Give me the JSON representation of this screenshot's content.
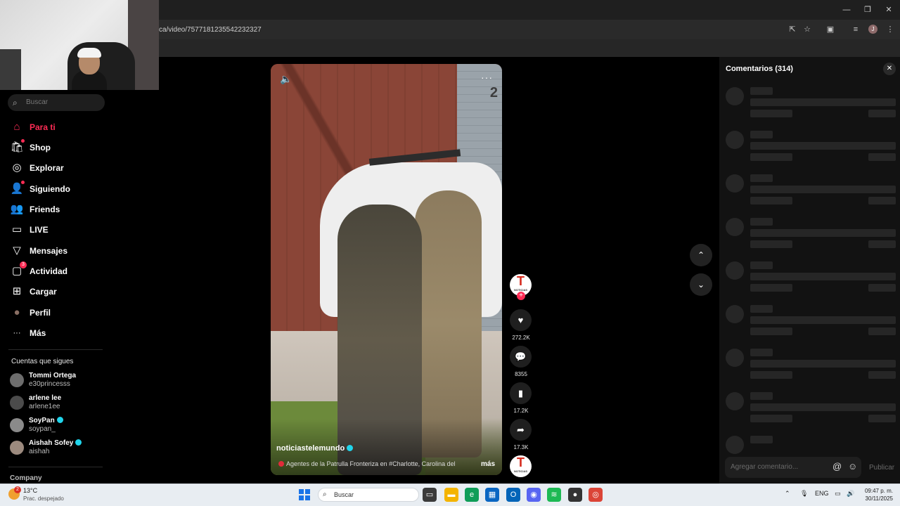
{
  "browser": {
    "url": "ca/video/7577181235542232327",
    "window_controls": {
      "minimize": "—",
      "restore": "❐",
      "close": "✕"
    },
    "profile_initial": "J"
  },
  "sidebar": {
    "search_placeholder": "Buscar",
    "items": [
      {
        "label": "Para ti",
        "icon": "⌂",
        "active": true
      },
      {
        "label": "Shop",
        "icon": "🛍"
      },
      {
        "label": "Explorar",
        "icon": "◎"
      },
      {
        "label": "Siguiendo",
        "icon": "👤"
      },
      {
        "label": "Friends",
        "icon": "👥"
      },
      {
        "label": "LIVE",
        "icon": "▭"
      },
      {
        "label": "Mensajes",
        "icon": "▽"
      },
      {
        "label": "Actividad",
        "icon": "▢",
        "badge": "3"
      },
      {
        "label": "Cargar",
        "icon": "⊞"
      },
      {
        "label": "Perfil",
        "icon": "●"
      },
      {
        "label": "Más",
        "icon": "···"
      }
    ],
    "following_title": "Cuentas que sigues",
    "following": [
      {
        "name": "Tommi Ortega",
        "handle": "e30princesss",
        "verified": false
      },
      {
        "name": "arlene lee",
        "handle": "arlene1ee",
        "verified": false
      },
      {
        "name": "SoyPan",
        "handle": "soypan_",
        "verified": true
      },
      {
        "name": "Aishah Sofey",
        "handle": "aishah",
        "verified": true
      }
    ],
    "company_label": "Company"
  },
  "video": {
    "house_number": "2",
    "author": "noticiastelemundo",
    "caption": "Agentes de la Patrulla Fronteriza en #Charlotte, Carolina del",
    "more_label": "más",
    "more_dots": "···",
    "volume_icon": "🔈"
  },
  "actions": {
    "channel_logo_letter": "T",
    "channel_logo_sub": "NOTICIAS",
    "likes": "272.2K",
    "comments": "8355",
    "saves": "17.2K",
    "shares": "17.3K"
  },
  "nav": {
    "up": "⌃",
    "down": "⌄"
  },
  "comments_panel": {
    "title": "Comentarios (314)",
    "close_icon": "✕",
    "input_placeholder": "Agregar comentario...",
    "mention_icon": "@",
    "emoji_icon": "☺",
    "publish_label": "Publicar"
  },
  "taskbar": {
    "weather_temp": "13°C",
    "weather_desc": "Prac. despejado",
    "weather_badge": "2",
    "search_placeholder": "Buscar",
    "lang": "ENG",
    "time": "09:47 p. m.",
    "date": "30/11/2025"
  },
  "colors": {
    "accent": "#fe2c55",
    "verified": "#20d5ec",
    "panel_bg": "#121212"
  }
}
